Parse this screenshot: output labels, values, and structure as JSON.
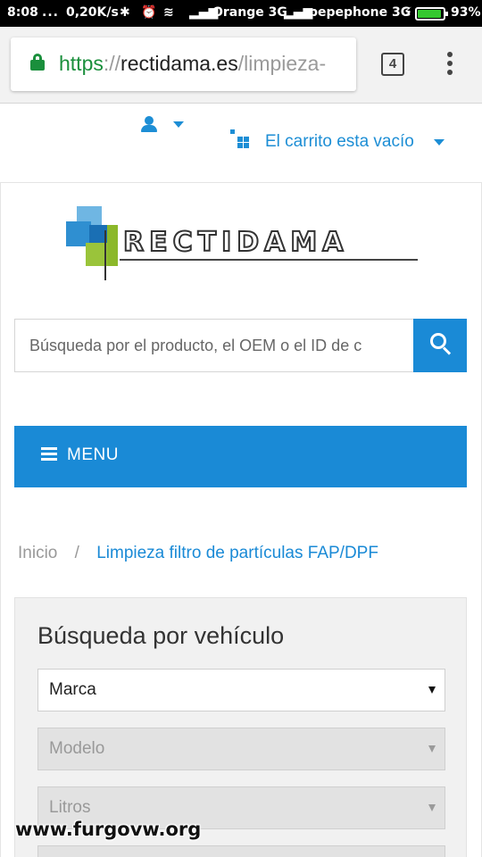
{
  "status_bar": {
    "time": "8:08",
    "dots": "...",
    "network_speed": "0,20K/s",
    "carrier1": "Orange 3G",
    "carrier2": "pepephone 3G",
    "battery_percent": "93%",
    "battery_level": 0.93,
    "icons": [
      "bluetooth-icon",
      "alarm-icon",
      "wifi-icon",
      "signal-icon",
      "signal-icon",
      "charging-icon",
      "battery-icon"
    ]
  },
  "browser": {
    "url_scheme": "https",
    "url_separator": "://",
    "url_host": "rectidama.es",
    "url_path": "/limpieza-",
    "tab_count": "4"
  },
  "header": {
    "cart_label": "El carrito esta vacío"
  },
  "logo": {
    "text": "RECTIDAMA",
    "colors": [
      "#6fb6e3",
      "#2f8fd1",
      "#1a6fb4",
      "#9ac43a"
    ]
  },
  "search": {
    "placeholder": "Búsqueda por el producto, el OEM o el ID de c"
  },
  "menu": {
    "label": "MENU"
  },
  "breadcrumb": {
    "home": "Inicio",
    "separator": "/",
    "current": "Limpieza filtro de partículas FAP/DPF"
  },
  "vehicle_search": {
    "title": "Búsqueda por vehículo",
    "selects": [
      "Marca",
      "Modelo",
      "Litros"
    ]
  },
  "watermark": "www.furgovw.org",
  "colors": {
    "accent": "#1a8ad6",
    "secure_green": "#1a8f3c"
  }
}
